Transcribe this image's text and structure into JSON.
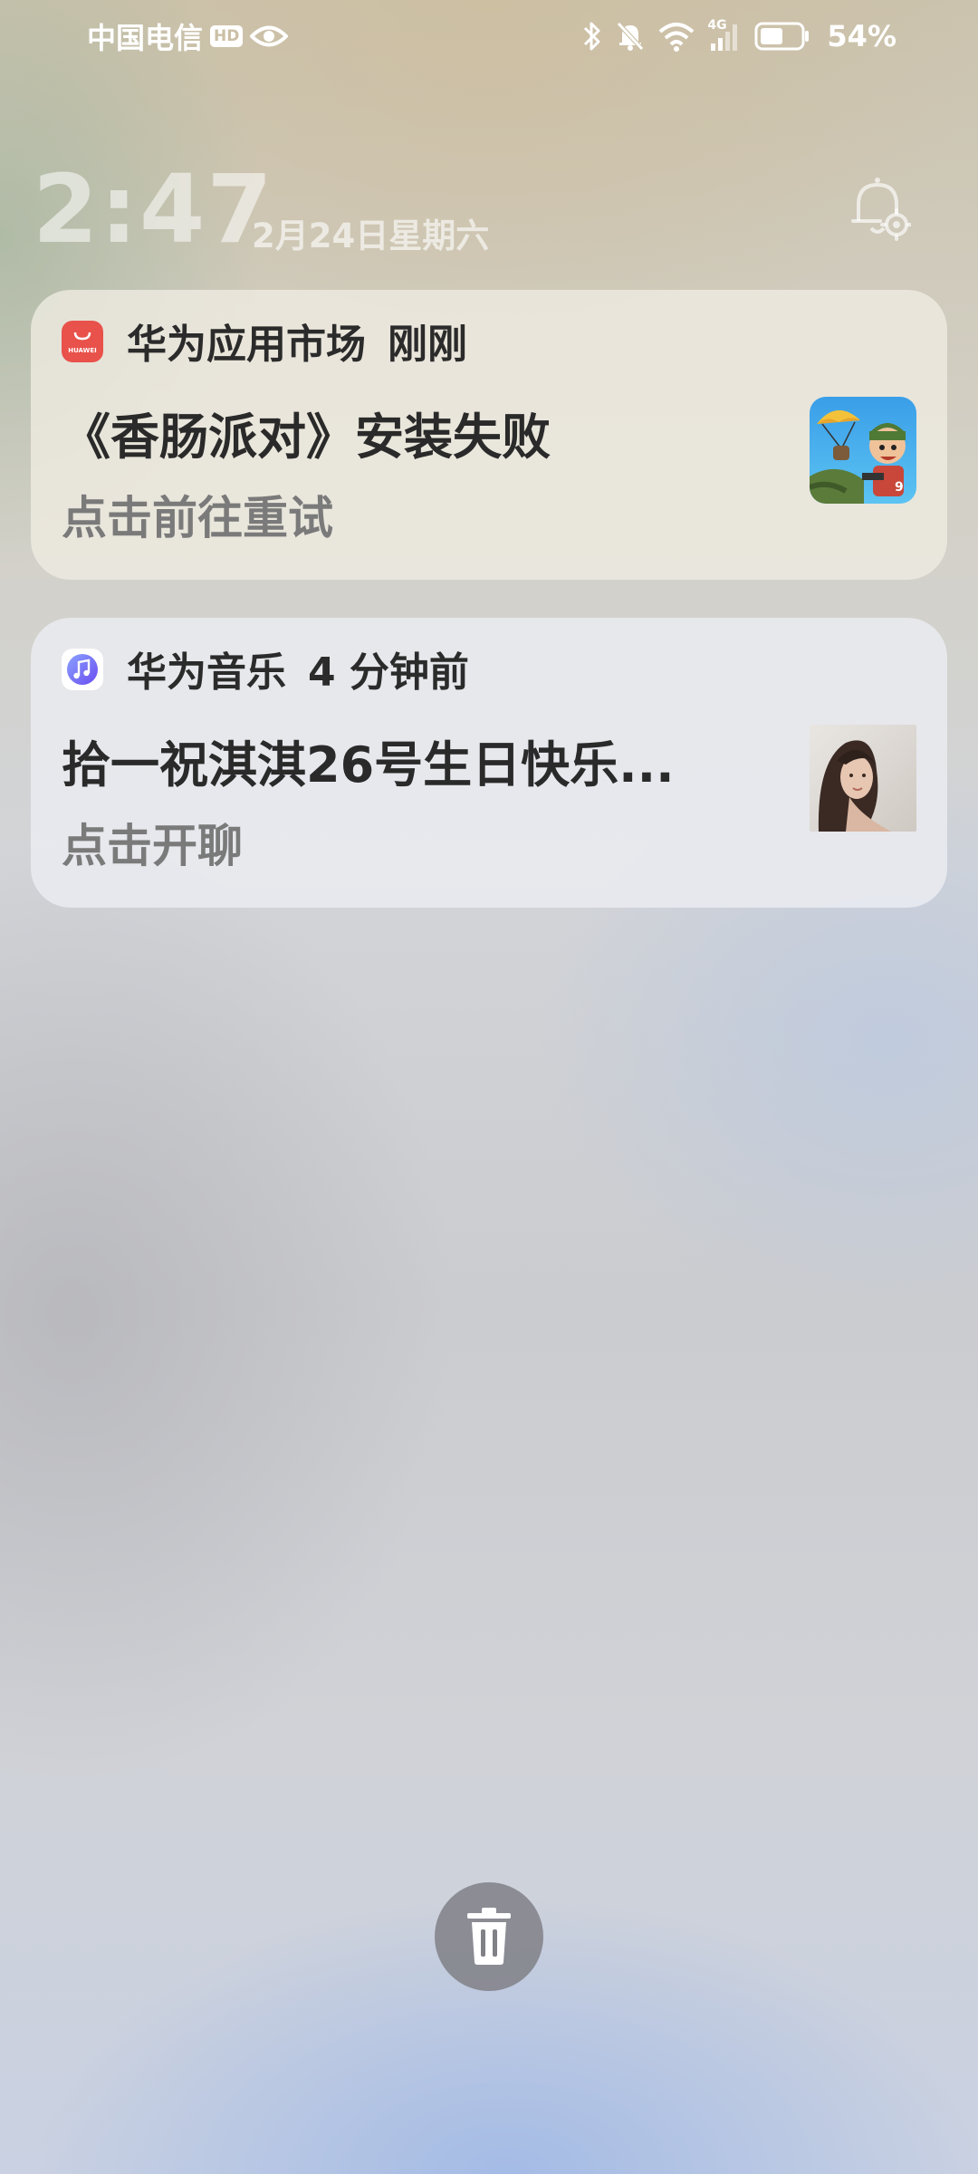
{
  "status_bar": {
    "carrier": "中国电信",
    "hd_badge": "HD",
    "network": "4G",
    "battery": "54%"
  },
  "lockscreen": {
    "time": "2:47",
    "date": "2月24日星期六"
  },
  "notifications": [
    {
      "app": "华为应用市场",
      "time": "刚刚",
      "title": "《香肠派对》安装失败",
      "body": "点击前往重试",
      "app_icon": "huawei-appgallery-icon",
      "icon_label": "HUAWEI",
      "icon_color": "#e8524a"
    },
    {
      "app": "华为音乐",
      "time": "4 分钟前",
      "title": "拾一祝淇淇26号生日快乐...",
      "body": "点击开聊",
      "app_icon": "huawei-music-icon",
      "icon_color": "#6a78f0"
    }
  ],
  "actions": {
    "clear_all_icon": "trash-icon"
  }
}
